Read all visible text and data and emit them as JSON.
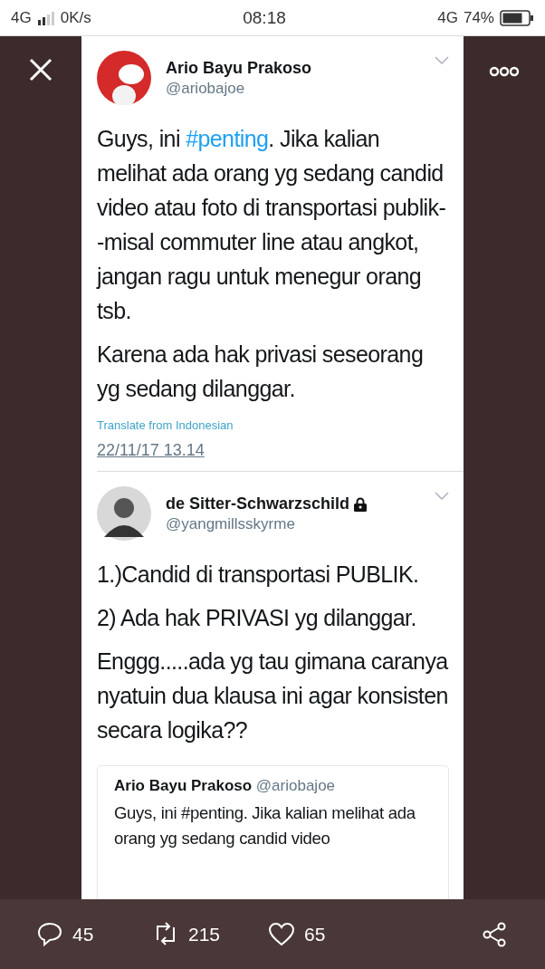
{
  "status_bar": {
    "network": "4G",
    "speed": "0K/s",
    "time": "08:18",
    "network_right": "4G",
    "battery": "74%"
  },
  "tweets": [
    {
      "name": "Ario Bayu Prakoso",
      "handle": "@ariobajoe",
      "locked": false,
      "paragraphs": [
        [
          {
            "text": "Guys, ini "
          },
          {
            "text": "#penting",
            "kind": "hashtag"
          },
          {
            "text": ". Jika kalian melihat ada orang yg sedang candid video atau foto di transportasi publik--misal commuter line atau angkot, jangan ragu untuk menegur orang tsb."
          }
        ],
        [
          {
            "text": "Karena ada hak privasi seseorang yg sedang dilanggar."
          }
        ]
      ],
      "translate": "Translate from Indonesian",
      "timestamp": "22/11/17 13.14"
    },
    {
      "name": "de Sitter-Schwarzschild",
      "handle": "@yangmillsskyrme",
      "locked": true,
      "paragraphs": [
        [
          {
            "text": "1.)Candid di transportasi PUBLIK."
          }
        ],
        [
          {
            "text": "2) Ada hak PRIVASI yg dilanggar."
          }
        ],
        [
          {
            "text": "Enggg.....ada yg tau gimana caranya nyatuin dua klausa ini agar konsisten secara logika??"
          }
        ]
      ],
      "quote": {
        "name": "Ario Bayu Prakoso",
        "handle": "@ariobajoe",
        "text": "Guys, ini #penting. Jika kalian melihat ada orang yg sedang candid video"
      }
    }
  ],
  "actions": [
    {
      "kind": "reply",
      "count": "45"
    },
    {
      "kind": "retweet",
      "count": "215"
    },
    {
      "kind": "like",
      "count": "65"
    },
    {
      "kind": "share"
    }
  ]
}
